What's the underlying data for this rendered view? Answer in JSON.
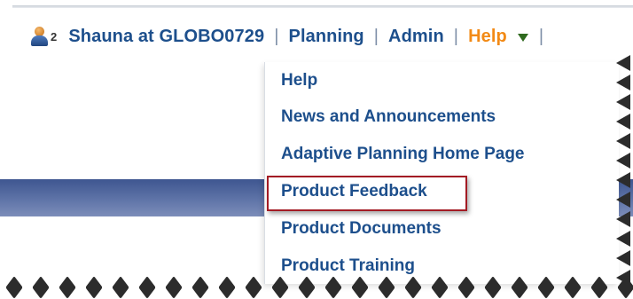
{
  "header": {
    "user_count": "2",
    "user_name": "Shauna at GLOBO0729",
    "separator": "|",
    "links": {
      "planning": "Planning",
      "admin": "Admin",
      "help": "Help"
    }
  },
  "help_menu": {
    "items": [
      {
        "label": "Help"
      },
      {
        "label": "News and Announcements"
      },
      {
        "label": "Adaptive Planning Home Page"
      },
      {
        "label": "Product Feedback"
      },
      {
        "label": "Product Documents"
      },
      {
        "label": "Product Training"
      }
    ],
    "highlighted_index": 3
  },
  "colors": {
    "link": "#1d4f8c",
    "help_active": "#f28a16",
    "highlight_border": "#a31b24",
    "banner": "#4d649c"
  },
  "icons": {
    "user": "user-icon",
    "dropdown": "dropdown-arrow-icon"
  }
}
